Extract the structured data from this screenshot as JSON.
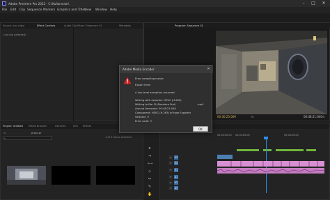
{
  "window": {
    "title": "Adobe Premiere Pro 2022 - C:\\Kullanıcılar\\",
    "minimize_glyph": "–",
    "maximize_glyph": "□",
    "close_glyph": "✕"
  },
  "menu": [
    "File",
    "Edit",
    "Clip",
    "Sequence",
    "Markers",
    "Graphics and Titles",
    "View",
    "Window",
    "Help"
  ],
  "source_panel": {
    "tabs": [
      "Source: (no clips)",
      "Effect Controls",
      "Audio Clip Mixer: Sequence 01",
      "Metadata"
    ],
    "no_clip_text": "(no clip selected)"
  },
  "program_panel": {
    "tab": "Program: Sequence 01",
    "timecode_left": "00:30:23:009",
    "fit_label": "Fit",
    "timecode_right": "00:48:21:040"
  },
  "dialog": {
    "title": "Adobe Media Encoder",
    "close_glyph": "✕",
    "error_icon": "error-icon",
    "lines": [
      "Error compiling movie.",
      "Export Error",
      "A low-level exception occurred.",
      "Writing with exporter: HEVC (H.265)",
      "Writing to file: D:\\Premiere Proi\\",
      "Around timecode: 00:48:21:040",
      "Component: HEVC (H.265) of type Exporter",
      "Selector: 9",
      "Error code: 3"
    ],
    "mp4_suffix": ".mp4",
    "ok_label": "OK"
  },
  "project_panel": {
    "tabs": [
      "Project: Untitled",
      "Media Browser",
      "Libraries",
      "Info",
      "Effects"
    ],
    "search_placeholder": "",
    "bin_label": "proje.pr",
    "item_count": "1 of 5 items selected"
  },
  "timeline": {
    "tab": "Sequence 01",
    "timecode": "00:30:23:009",
    "ruler": [
      "00:00:00:00",
      "04:00:00:00",
      "00:08:00:00"
    ],
    "tracks": [
      "V3",
      "V2",
      "V1",
      "A1",
      "A2",
      "A3"
    ]
  },
  "colors": {
    "accent_blue": "#2d8ceb",
    "error_red": "#d32323",
    "clip_pink": "#d98fd4",
    "audio_green": "#6fb53b"
  }
}
